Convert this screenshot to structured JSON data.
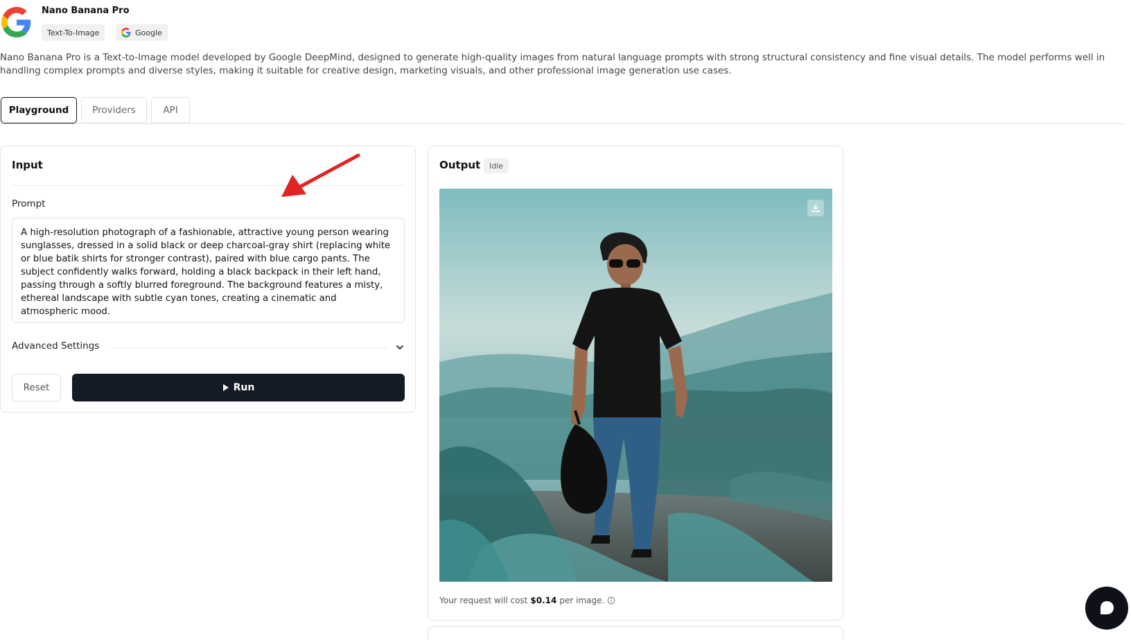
{
  "model": {
    "name": "Nano Banana Pro",
    "category_tag": "Text-To-Image",
    "provider_tag": "Google",
    "description": "Nano Banana Pro is a Text-to-Image model developed by Google DeepMind, designed to generate high-quality images from natural language prompts with strong structural consistency and fine visual details. The model performs well in handling complex prompts and diverse styles, making it suitable for creative design, marketing visuals, and other professional image generation use cases."
  },
  "tabs": [
    {
      "label": "Playground",
      "active": true
    },
    {
      "label": "Providers",
      "active": false
    },
    {
      "label": "API",
      "active": false
    }
  ],
  "input": {
    "title": "Input",
    "prompt_label": "Prompt",
    "prompt_value": "A high-resolution photograph of a fashionable, attractive young person wearing sunglasses, dressed in a solid black or deep charcoal-gray shirt (replacing white or blue batik shirts for stronger contrast), paired with blue cargo pants. The subject confidently walks forward, holding a black backpack in their left hand, passing through a softly blurred foreground. The background features a misty, ethereal landscape with subtle cyan tones, creating a cinematic and atmospheric mood.",
    "advanced_label": "Advanced Settings",
    "reset_label": "Reset",
    "run_label": "Run"
  },
  "output": {
    "title": "Output",
    "status": "Idle",
    "cost_prefix": "Your request will cost",
    "cost_value": "$0.14",
    "cost_suffix": "per image."
  },
  "icons": {
    "logo": "google-logo-icon",
    "download": "download-icon",
    "chevron": "chevron-down-icon",
    "play": "play-icon",
    "info": "info-icon",
    "chat": "chat-icon"
  },
  "colors": {
    "run_button": "#141a26",
    "annotation_arrow": "#e02424",
    "chat_bubble": "#0e1117"
  }
}
